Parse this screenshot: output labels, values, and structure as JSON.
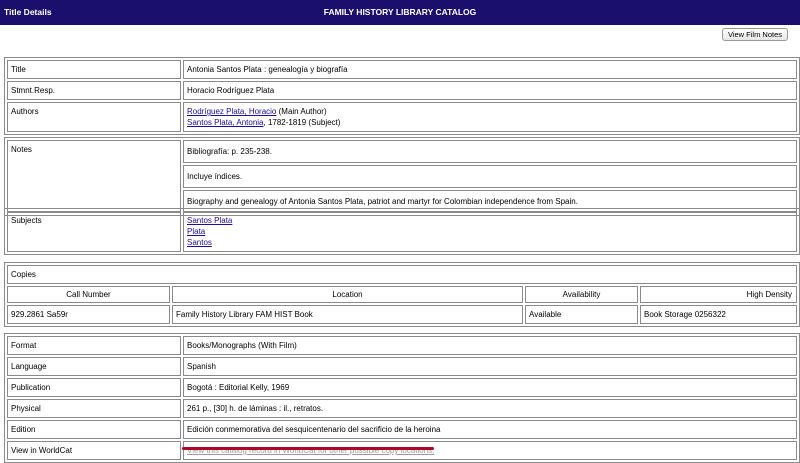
{
  "header": {
    "left_title": "Title Details",
    "center_title": "FAMILY HISTORY LIBRARY CATALOG"
  },
  "toolbar": {
    "view_film_notes_label": "View Film Notes"
  },
  "details": {
    "title_label": "Title",
    "title_value": "Antonia Santos Plata : genealogía y biografía",
    "stmnt_label": "Stmnt.Resp.",
    "stmnt_value": "Horacio Rodríguez Plata",
    "authors_label": "Authors",
    "author1_link": "Rodríguez Plata, Horacio",
    "author1_role": " (Main Author)",
    "author2_link": "Santos Plata, Antonia",
    "author2_role": ", 1782-1819 (Subject)"
  },
  "notes": {
    "label": "Notes",
    "items": [
      "Bibliografía: p. 235-238.",
      "Incluye índices.",
      "Biography and genealogy of Antonia Santos Plata, patriot and martyr for Colombian independence from Spain."
    ]
  },
  "subjects": {
    "label": "Subjects",
    "items": [
      "Santos Plata",
      "Plata",
      "Santos"
    ]
  },
  "copies": {
    "label": "Copies",
    "headers": [
      "Call Number",
      "Location",
      "Availability",
      "High Density"
    ],
    "row": [
      "929.2861 Sa59r",
      "Family History Library FAM HIST Book",
      "Available",
      "Book Storage 0256322"
    ]
  },
  "format": {
    "format_label": "Format",
    "format_value": "Books/Monographs (With Film)",
    "language_label": "Language",
    "language_value": "Spanish",
    "publication_label": "Publication",
    "publication_value": "Bogotá : Editorial Kelly, 1969",
    "physical_label": "Physical",
    "physical_value": "261 p., [30] h. de láminas : il., retratos.",
    "edition_label": "Edition",
    "edition_value": "Edición conmemorativa del sesquicentenario del sacrificio de la heroina",
    "worldcat_label": "View in WorldCat",
    "worldcat_link": "View this catalog record in WorldCat for other possible copy locations."
  }
}
